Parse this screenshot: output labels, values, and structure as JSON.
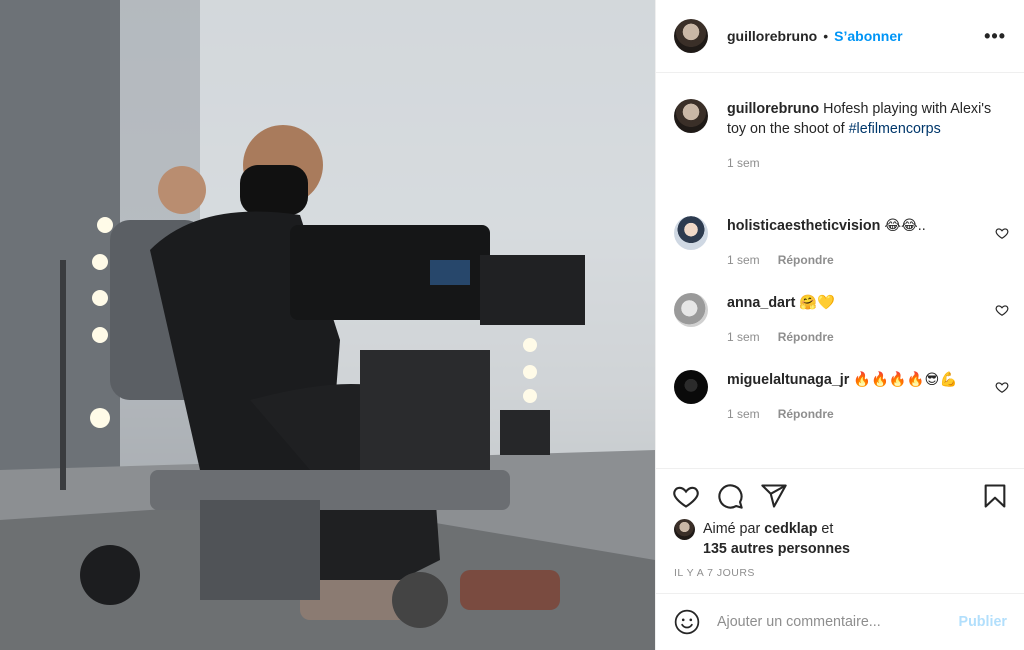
{
  "post": {
    "author": "guillorebruno",
    "separator": "•",
    "follow_label": "S’abonner",
    "more_label": "•••"
  },
  "caption": {
    "username": "guillorebruno",
    "text": " Hofesh playing with Alexi's toy on the shoot of ",
    "hashtag": "#lefilmencorps",
    "time": "1 sem"
  },
  "comments": [
    {
      "username": "holisticaestheticvision",
      "text": " 😂😂..",
      "time": "1 sem",
      "reply_label": "Répondre"
    },
    {
      "username": "anna_dart",
      "text": " 🤗💛",
      "time": "1 sem",
      "reply_label": "Répondre"
    },
    {
      "username": "miguelaltunaga_jr",
      "text": " 🔥🔥🔥🔥😎💪",
      "time": "1 sem",
      "reply_label": "Répondre"
    }
  ],
  "likes": {
    "prefix": "Aimé par ",
    "liker": "cedklap",
    "suffix": " et",
    "others": "135 autres personnes"
  },
  "timestamp": "IL Y A 7 JOURS",
  "comment_box": {
    "placeholder": "Ajouter un commentaire...",
    "post_label": "Publier"
  },
  "icons": {
    "like": "heart-icon",
    "comment": "comment-icon",
    "share": "share-icon",
    "save": "bookmark-icon",
    "emoji": "emoji-icon"
  },
  "colors": {
    "link_blue": "#0095f6",
    "hashtag": "#00376b",
    "muted": "#8e8e8e",
    "publish_disabled": "#b2dffc"
  }
}
